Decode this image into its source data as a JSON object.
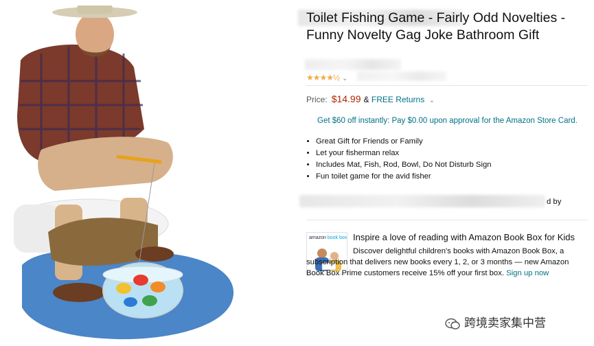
{
  "product": {
    "title": "Toilet Fishing Game - Fairly Odd Novelties - Funny Novelty Gag Joke Bathroom Gift",
    "rating_stars": "★★★★½",
    "rating_value": 4.5,
    "price_label": "Price:",
    "price": "$14.99",
    "returns_prefix": "&",
    "returns": "FREE Returns",
    "promo": "Get $60 off instantly: Pay $0.00 upon approval for the Amazon Store Card.",
    "bullets": [
      "Great Gift for Friends or Family",
      "Let your fisherman relax",
      "Includes Mat, Fish, Rod, Bowl, Do Not Disturb Sign",
      "Fun toilet game for the avid fisher"
    ],
    "sold_by_suffix": "d by"
  },
  "book_box": {
    "logo_text": "amazon",
    "logo_brand": "book box",
    "heading": "Inspire a love of reading with Amazon Book Box for Kids",
    "description": "Discover delightful children's books with Amazon Book Box, a subscription that delivers new books every 1, 2, or 3 months — new Amazon Book Box Prime customers receive 15% off your first box.",
    "link": "Sign up now"
  },
  "watermark": {
    "text": "跨境卖家集中营"
  },
  "colors": {
    "price": "#b12704",
    "link": "#007185",
    "star": "#f3a847"
  }
}
